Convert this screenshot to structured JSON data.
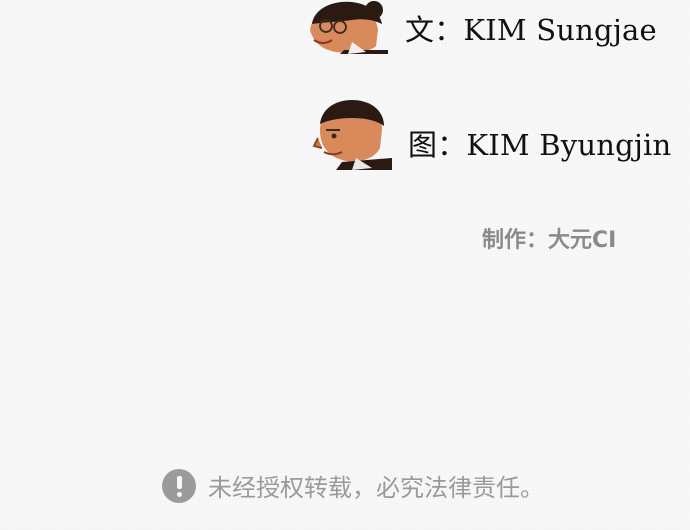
{
  "credits": {
    "writer": "文：KIM Sungjae",
    "artist": "图：KIM Byungjin",
    "producer": "制作：大元CI"
  },
  "notice": {
    "icon": "exclamation-circle-icon",
    "text": "未经授权转载，必究法律责任。"
  }
}
